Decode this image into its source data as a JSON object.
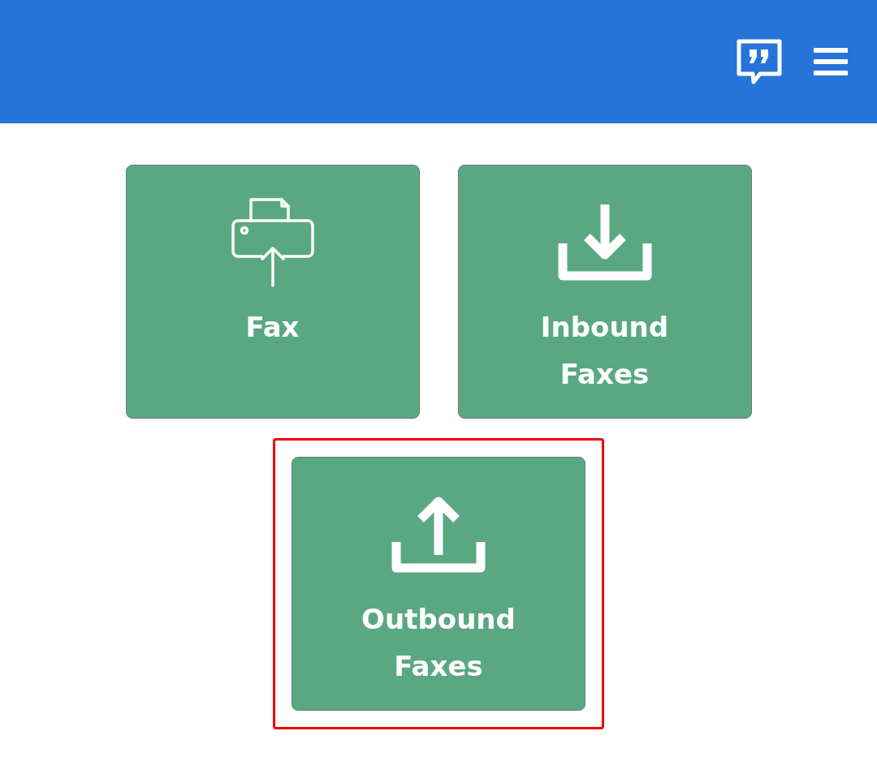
{
  "header": {
    "actions": [
      {
        "kind": "feedback"
      },
      {
        "kind": "menu"
      }
    ]
  },
  "tiles": [
    {
      "label": "Fax",
      "kind": "printer",
      "highlighted": false
    },
    {
      "label": "Inbound Faxes",
      "kind": "download",
      "highlighted": false
    },
    {
      "label": "Outbound Faxes",
      "kind": "upload",
      "highlighted": true
    }
  ]
}
